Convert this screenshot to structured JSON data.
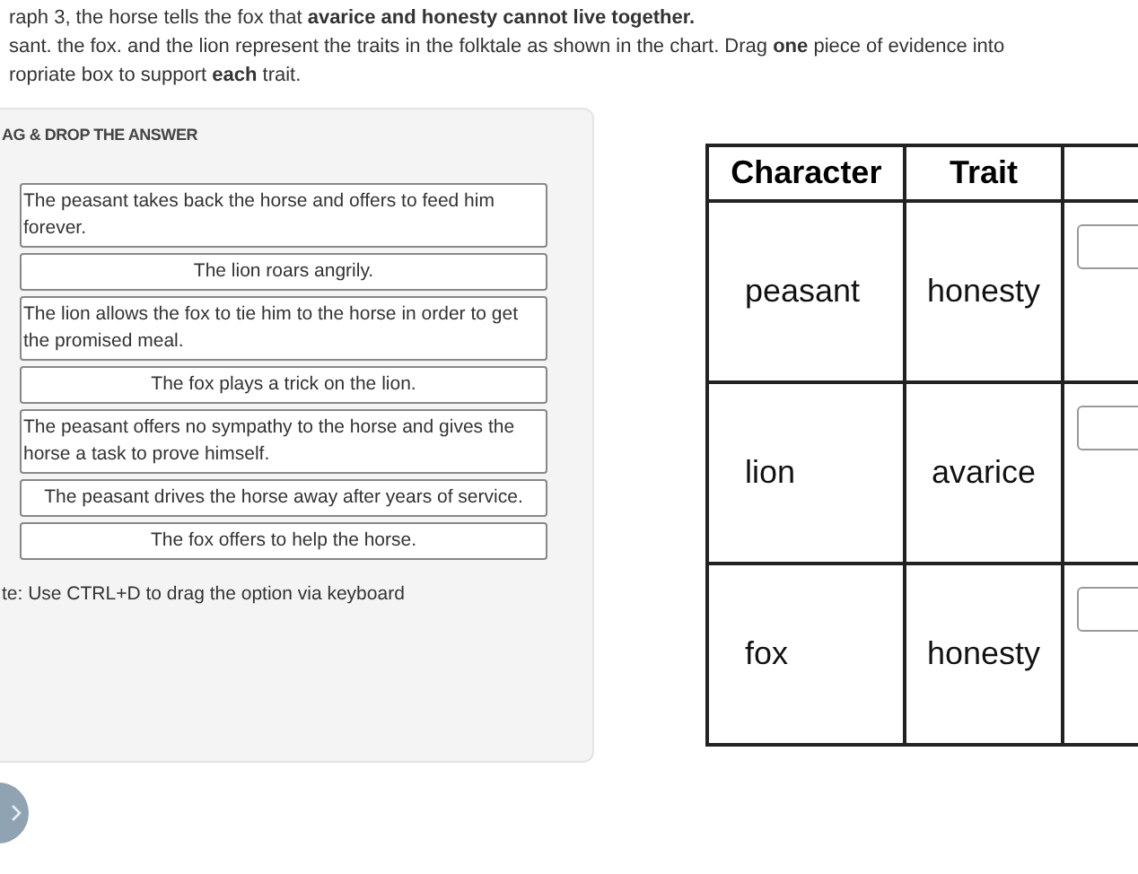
{
  "instructions": [
    "raph 3, the horse tells the fox that **avarice and honesty cannot live together.**",
    "sant. the fox. and the lion represent the traits in the folktale as shown in the chart. Drag **one** piece of evidence into",
    "ropriate box to support **each** trait."
  ],
  "panel": {
    "heading": "AG & DROP THE ANSWER",
    "options": [
      {
        "text": "The peasant takes back the horse and offers to feed him forever.",
        "kind": "wrapped"
      },
      {
        "text": "The lion roars angrily.",
        "kind": "centered"
      },
      {
        "text": "The lion allows the fox to tie him to the horse in order to get the promised meal.",
        "kind": "wrapped"
      },
      {
        "text": "The fox plays a trick on the lion.",
        "kind": "centered"
      },
      {
        "text": "The peasant offers no sympathy to the horse and gives the horse a task to prove himself.",
        "kind": "wrapped"
      },
      {
        "text": "The peasant drives the horse away after years of service.",
        "kind": "centered"
      },
      {
        "text": "The fox offers to help the horse.",
        "kind": "centered"
      }
    ],
    "note": "te: Use CTRL+D to drag the option via keyboard"
  },
  "table": {
    "columns": [
      "Character",
      "Trait"
    ],
    "rows": [
      {
        "character": "peasant",
        "trait": "honesty"
      },
      {
        "character": "lion",
        "trait": "avarice"
      },
      {
        "character": "fox",
        "trait": "honesty"
      }
    ]
  }
}
